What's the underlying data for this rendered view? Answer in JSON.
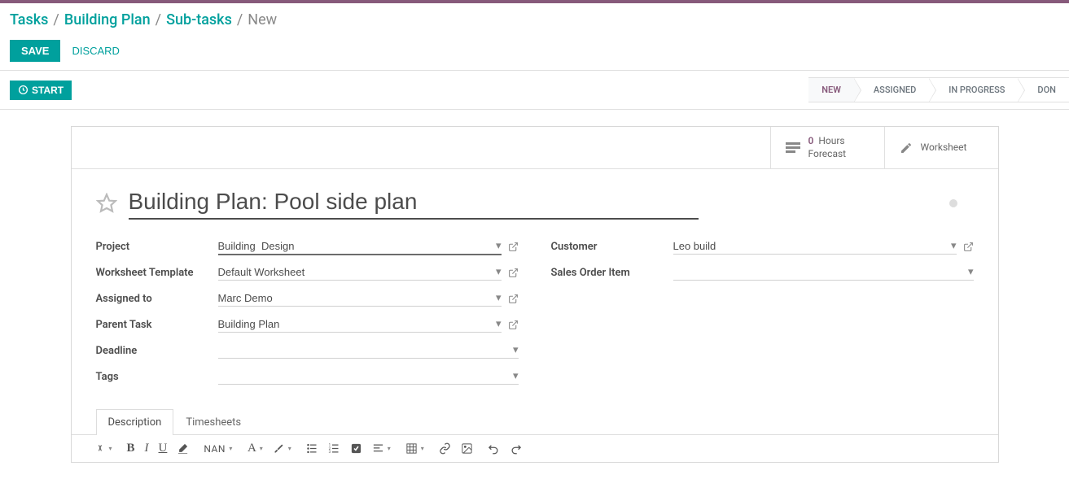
{
  "breadcrumb": {
    "items": [
      "Tasks",
      "Building Plan",
      "Sub-tasks"
    ],
    "current": "New"
  },
  "actions": {
    "save": "SAVE",
    "discard": "DISCARD",
    "start": "START"
  },
  "stages": [
    "NEW",
    "ASSIGNED",
    "IN PROGRESS",
    "DON"
  ],
  "stats": {
    "hours_num": "0",
    "hours_label": "Hours",
    "forecast": "Forecast",
    "worksheet": "Worksheet"
  },
  "title": "Building Plan: Pool side plan",
  "fields_left": {
    "project": {
      "label": "Project",
      "value": "Building  Design"
    },
    "template": {
      "label": "Worksheet Template",
      "value": "Default Worksheet"
    },
    "assigned": {
      "label": "Assigned to",
      "value": "Marc Demo"
    },
    "parent": {
      "label": "Parent Task",
      "value": "Building Plan"
    },
    "deadline": {
      "label": "Deadline",
      "value": ""
    },
    "tags": {
      "label": "Tags",
      "value": ""
    }
  },
  "fields_right": {
    "customer": {
      "label": "Customer",
      "value": "Leo build"
    },
    "sales_item": {
      "label": "Sales Order Item",
      "value": ""
    }
  },
  "tabs": [
    "Description",
    "Timesheets"
  ],
  "toolbar": {
    "nan": "NAN"
  }
}
